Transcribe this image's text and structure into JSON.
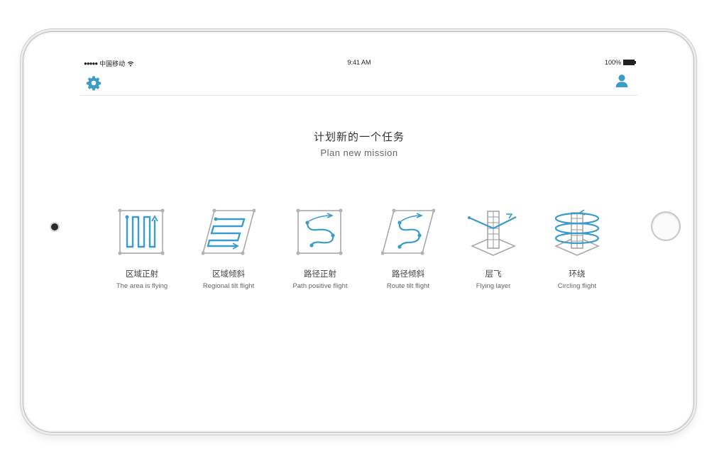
{
  "status_bar": {
    "carrier": "中国移动",
    "time": "9:41 AM",
    "battery": "100%",
    "battery_fraction": 1.0
  },
  "nav": {
    "settings_icon": "gear-icon",
    "profile_icon": "user-icon"
  },
  "header": {
    "title_zh": "计划新的一个任务",
    "title_en": "Plan new mission"
  },
  "missions": [
    {
      "zh": "区域正射",
      "en": "The area is flying",
      "icon": "area-orthographic-icon"
    },
    {
      "zh": "区域倾斜",
      "en": "Regional tilt flight",
      "icon": "area-tilt-icon"
    },
    {
      "zh": "路径正射",
      "en": "Path positive flight",
      "icon": "path-orthographic-icon"
    },
    {
      "zh": "路径倾斜",
      "en": "Route tilt flight",
      "icon": "path-tilt-icon"
    },
    {
      "zh": "层飞",
      "en": "Flying layer",
      "icon": "layer-flight-icon"
    },
    {
      "zh": "环绕",
      "en": "Circling flight",
      "icon": "circling-flight-icon"
    }
  ],
  "colors": {
    "accent": "#3a9cc9",
    "frame_gray": "#a9a9a9"
  }
}
